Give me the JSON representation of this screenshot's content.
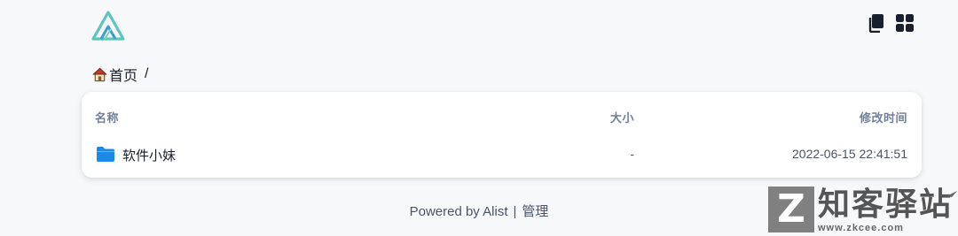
{
  "header": {
    "logo_icon": "alist-logo",
    "actions": [
      {
        "icon": "copy-icon"
      },
      {
        "icon": "grid-view-icon"
      }
    ]
  },
  "breadcrumb": {
    "home_icon": "home-icon",
    "home_label": "首页",
    "separator": "/"
  },
  "table": {
    "columns": {
      "name": "名称",
      "size": "大小",
      "modified": "修改时间"
    },
    "rows": [
      {
        "icon": "folder-icon",
        "name": "软件小妹",
        "size": "-",
        "modified": "2022-06-15 22:41:51"
      }
    ]
  },
  "footer": {
    "powered": "Powered by Alist",
    "separator": "|",
    "manage": "管理"
  },
  "watermark": {
    "letter": "Z",
    "brand": "知客驿站",
    "domain": "www.zkcee.com"
  },
  "colors": {
    "accent": "#4fb3b8",
    "folder": "#1e88e5",
    "background": "#f7f8fa"
  }
}
